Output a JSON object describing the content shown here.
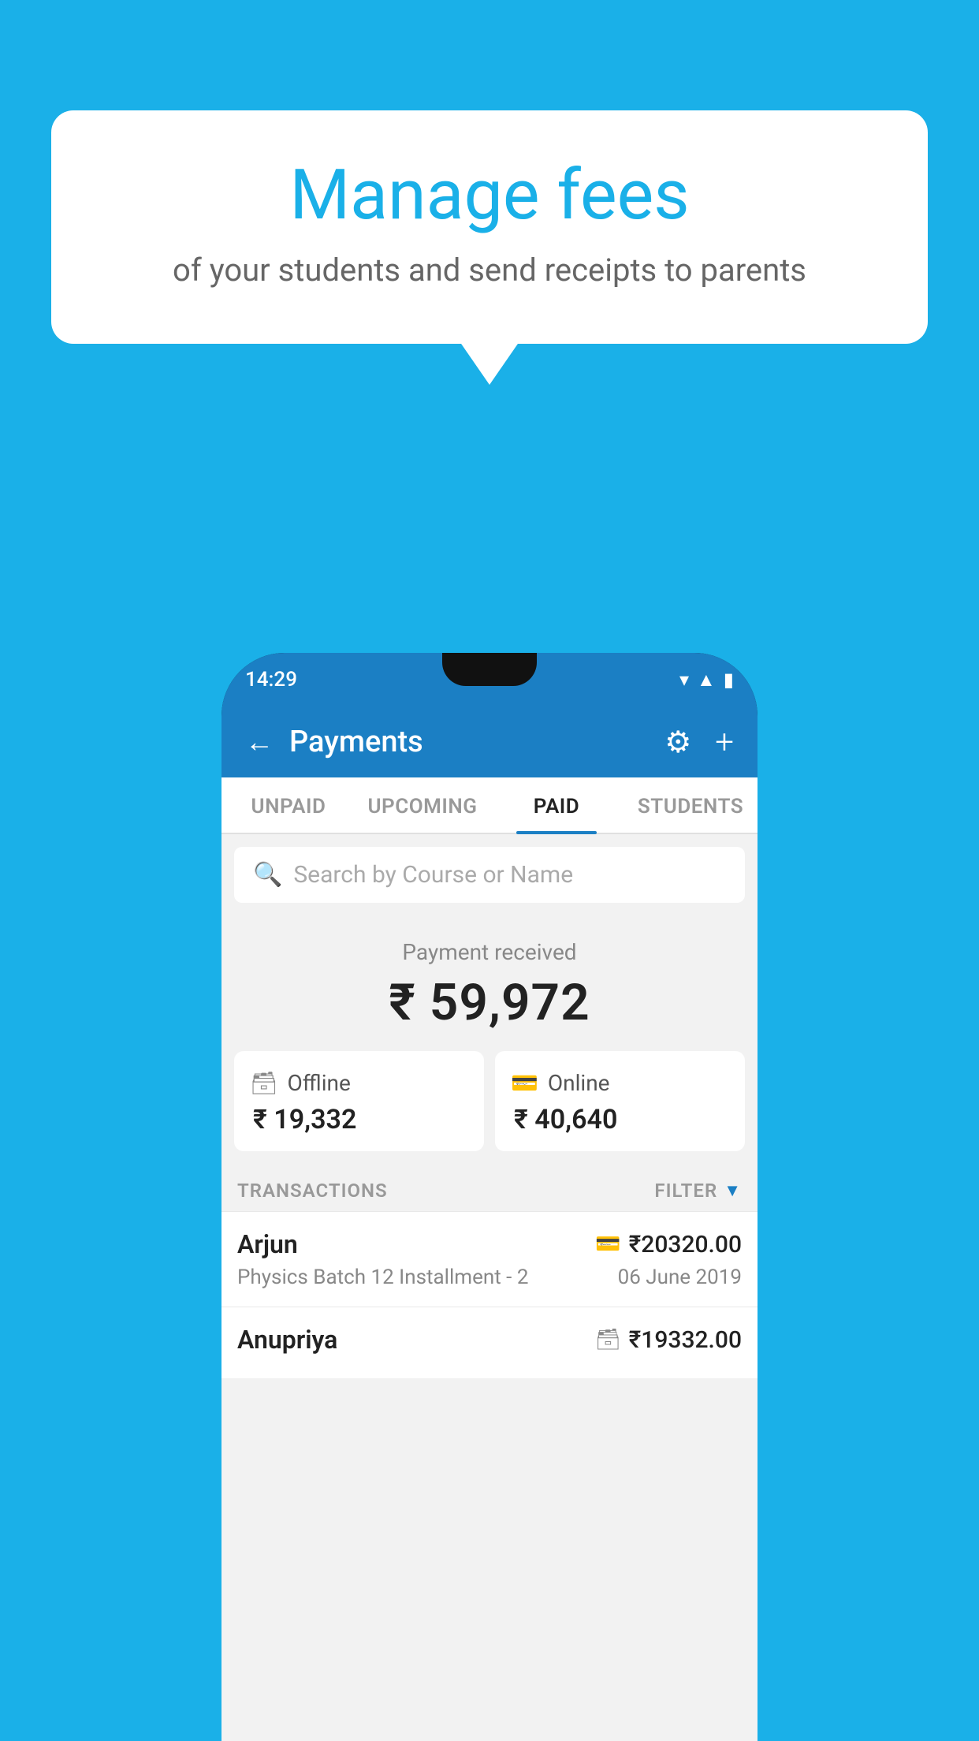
{
  "background_color": "#1ab0e8",
  "speech_bubble": {
    "title": "Manage fees",
    "subtitle": "of your students and send receipts to parents"
  },
  "phone": {
    "status_bar": {
      "time": "14:29",
      "icons": [
        "wifi",
        "signal",
        "battery"
      ]
    },
    "header": {
      "title": "Payments",
      "back_label": "←",
      "gear_label": "⚙",
      "plus_label": "+"
    },
    "tabs": [
      {
        "label": "UNPAID",
        "active": false
      },
      {
        "label": "UPCOMING",
        "active": false
      },
      {
        "label": "PAID",
        "active": true
      },
      {
        "label": "STUDENTS",
        "active": false
      }
    ],
    "search": {
      "placeholder": "Search by Course or Name"
    },
    "payment_summary": {
      "label": "Payment received",
      "amount": "₹ 59,972"
    },
    "payment_cards": [
      {
        "icon": "offline",
        "label": "Offline",
        "amount": "₹ 19,332"
      },
      {
        "icon": "online",
        "label": "Online",
        "amount": "₹ 40,640"
      }
    ],
    "transactions_section": {
      "label": "TRANSACTIONS",
      "filter_label": "FILTER"
    },
    "transactions": [
      {
        "name": "Arjun",
        "amount": "₹20320.00",
        "course": "Physics Batch 12 Installment - 2",
        "date": "06 June 2019",
        "payment_type": "online"
      },
      {
        "name": "Anupriya",
        "amount": "₹19332.00",
        "course": "",
        "date": "",
        "payment_type": "offline"
      }
    ]
  }
}
